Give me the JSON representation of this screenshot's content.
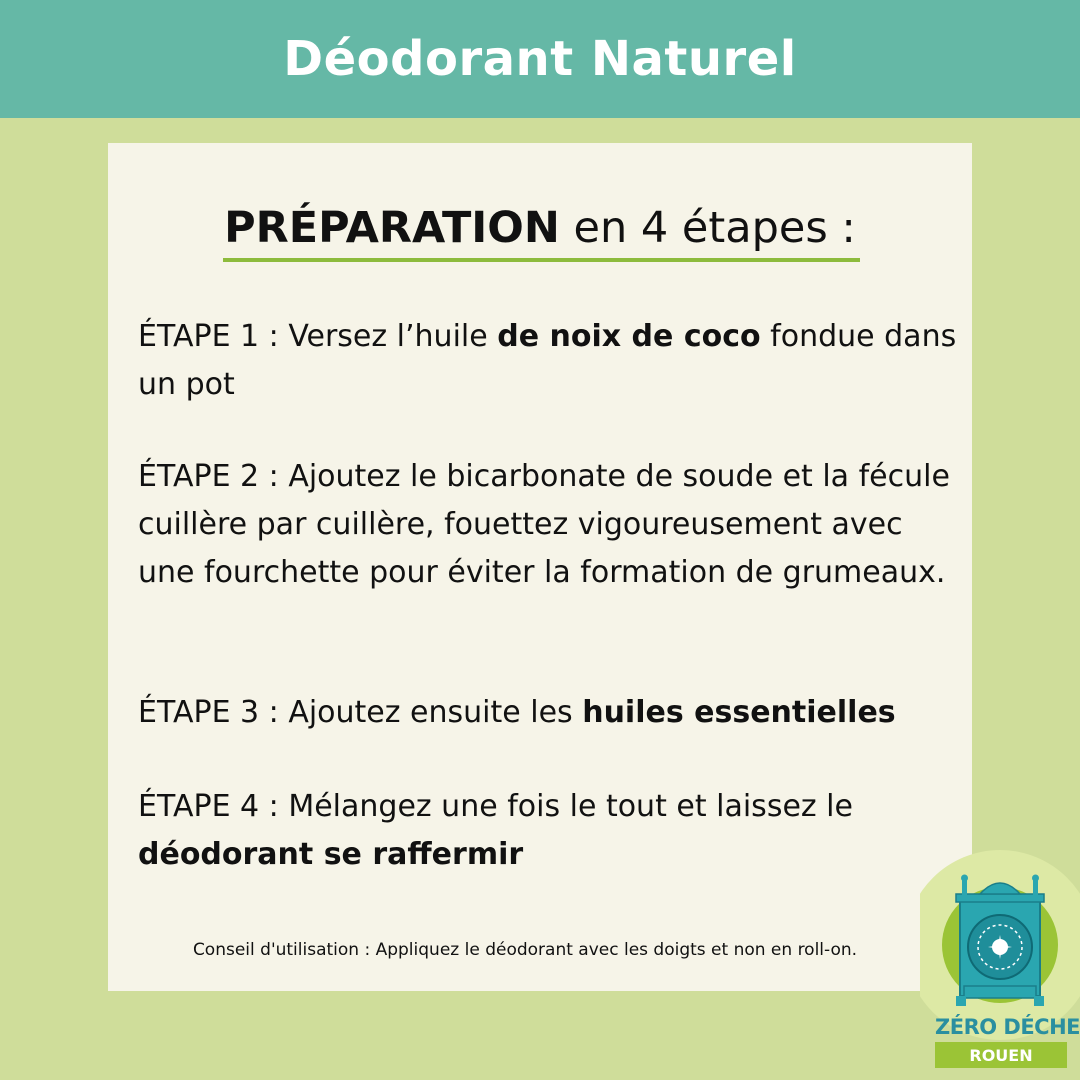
{
  "header": {
    "title": "Déodorant Naturel"
  },
  "card": {
    "title_bold": "PRÉPARATION",
    "title_rest": " en 4 étapes :",
    "steps": [
      {
        "prefix": "ÉTAPE 1 : Versez l’huile ",
        "bold": "de noix de coco",
        "suffix": " fondue dans un pot"
      },
      {
        "prefix": "ÉTAPE 2 : Ajoutez le bicarbonate de soude et la fécule cuillère par cuillère, fouettez vigoureusement avec une fourchette pour éviter la formation de grumeaux.",
        "bold": "",
        "suffix": ""
      },
      {
        "prefix": "ÉTAPE 3 : Ajoutez ensuite les ",
        "bold": "huiles essentielles",
        "suffix": ""
      },
      {
        "prefix": "ÉTAPE 4 : Mélangez une fois le tout et laissez le ",
        "bold": "déodorant se raffermir",
        "suffix": ""
      }
    ],
    "tip": "Conseil d'utilisation : Appliquez le déodorant avec les doigts et non en roll-on."
  },
  "logo": {
    "name_part1": "ZÉRO ",
    "name_part2": "DÉCHET",
    "city": "ROUEN"
  },
  "colors": {
    "header": "#65b8a6",
    "background": "#cfdd9a",
    "card": "#f6f4e8",
    "accent": "#8dbb3c",
    "logo_teal": "#2a8fa0"
  }
}
